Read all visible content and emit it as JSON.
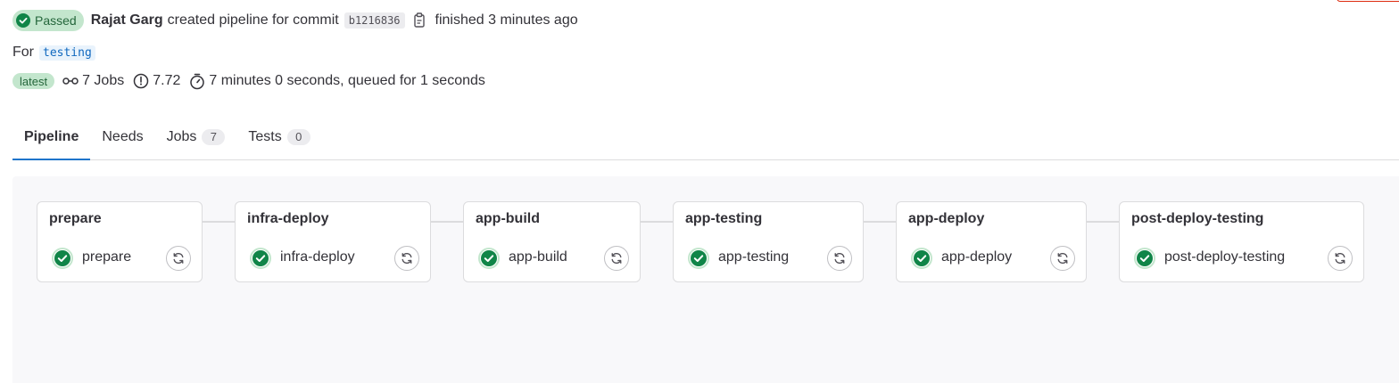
{
  "header": {
    "status_label": "Passed",
    "author": "Rajat Garg",
    "action_text": "created pipeline for commit",
    "commit_sha": "b1216836",
    "finished_text": "finished 3 minutes ago",
    "for_label": "For",
    "ref": "testing",
    "latest_label": "latest",
    "jobs_text": "7 Jobs",
    "compute_text": "7.72",
    "duration_text": "7 minutes 0 seconds, queued for 1 seconds"
  },
  "tabs": [
    {
      "label": "Pipeline",
      "count": null
    },
    {
      "label": "Needs",
      "count": null
    },
    {
      "label": "Jobs",
      "count": "7"
    },
    {
      "label": "Tests",
      "count": "0"
    }
  ],
  "stages": [
    {
      "title": "prepare",
      "job": "prepare"
    },
    {
      "title": "infra-deploy",
      "job": "infra-deploy"
    },
    {
      "title": "app-build",
      "job": "app-build"
    },
    {
      "title": "app-testing",
      "job": "app-testing"
    },
    {
      "title": "app-deploy",
      "job": "app-deploy"
    },
    {
      "title": "post-deploy-testing",
      "job": "post-deploy-testing"
    }
  ],
  "colors": {
    "success": "#108548",
    "success_bg": "#c3e6cd",
    "link": "#1f75cb"
  },
  "icons": {
    "status": "status-success-icon",
    "copy": "copy-to-clipboard-icon",
    "jobs": "pipeline-icon",
    "compute": "timer-icon",
    "duration": "stopwatch-icon",
    "retry": "retry-icon"
  }
}
